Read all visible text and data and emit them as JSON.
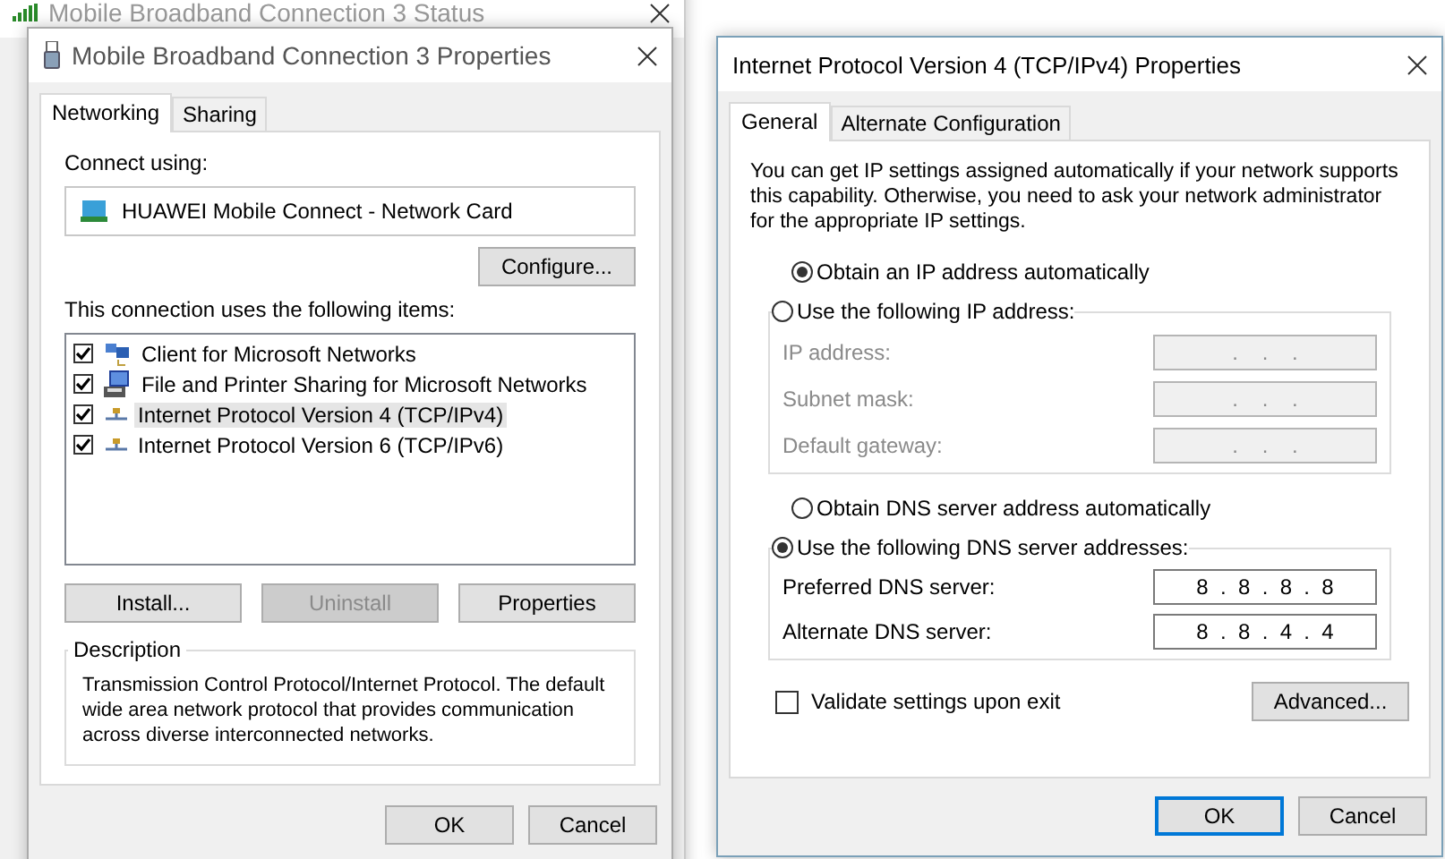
{
  "status_window": {
    "title": "Mobile Broadband Connection 3 Status"
  },
  "properties_window": {
    "title": "Mobile Broadband Connection 3 Properties",
    "tabs": [
      {
        "label": "Networking",
        "selected": true
      },
      {
        "label": "Sharing",
        "selected": false
      }
    ],
    "connect_using_label": "Connect using:",
    "adapter": "HUAWEI Mobile Connect - Network Card",
    "configure_button": "Configure...",
    "items_label": "This connection uses the following items:",
    "items": [
      {
        "label": "Client for Microsoft Networks",
        "checked": true,
        "selected": false,
        "kind": "client"
      },
      {
        "label": "File and Printer Sharing for Microsoft Networks",
        "checked": true,
        "selected": false,
        "kind": "sharing"
      },
      {
        "label": "Internet Protocol Version 4 (TCP/IPv4)",
        "checked": true,
        "selected": true,
        "kind": "protocol"
      },
      {
        "label": "Internet Protocol Version 6 (TCP/IPv6)",
        "checked": true,
        "selected": false,
        "kind": "protocol"
      }
    ],
    "buttons": [
      {
        "label": "Install...",
        "disabled": false
      },
      {
        "label": "Uninstall",
        "disabled": true
      },
      {
        "label": "Properties",
        "disabled": false
      }
    ],
    "description": {
      "legend": "Description",
      "text": "Transmission Control Protocol/Internet Protocol. The default wide area network protocol that provides communication across diverse interconnected networks."
    },
    "dialog_buttons": [
      {
        "label": "OK",
        "default": false
      },
      {
        "label": "Cancel",
        "default": false
      }
    ]
  },
  "ipv4_window": {
    "title": "Internet Protocol Version 4 (TCP/IPv4) Properties",
    "tabs": [
      {
        "label": "General",
        "selected": true
      },
      {
        "label": "Alternate Configuration",
        "selected": false
      }
    ],
    "intro": "You can get IP settings assigned automatically if your network supports this capability. Otherwise, you need to ask your network administrator for the appropriate IP settings.",
    "ip_options": [
      {
        "label": "Obtain an IP address automatically",
        "selected": true
      },
      {
        "label": "Use the following IP address:",
        "selected": false
      }
    ],
    "ip_fields": [
      {
        "label": "IP address:",
        "value": ".    .    .",
        "disabled": true
      },
      {
        "label": "Subnet mask:",
        "value": ".    .    .",
        "disabled": true
      },
      {
        "label": "Default gateway:",
        "value": ".    .    .",
        "disabled": true
      }
    ],
    "dns_options": [
      {
        "label": "Obtain DNS server address automatically",
        "selected": false
      },
      {
        "label": "Use the following DNS server addresses:",
        "selected": true
      }
    ],
    "dns_fields": [
      {
        "label": "Preferred DNS server:",
        "value": "8  .  8  .  8  .  8",
        "disabled": false
      },
      {
        "label": "Alternate DNS server:",
        "value": "8  .  8  .  4  .  4",
        "disabled": false
      }
    ],
    "validate": {
      "label": "Validate settings upon exit",
      "checked": false
    },
    "advanced_button": "Advanced...",
    "dialog_buttons": [
      {
        "label": "OK",
        "default": true
      },
      {
        "label": "Cancel",
        "default": false
      }
    ]
  }
}
